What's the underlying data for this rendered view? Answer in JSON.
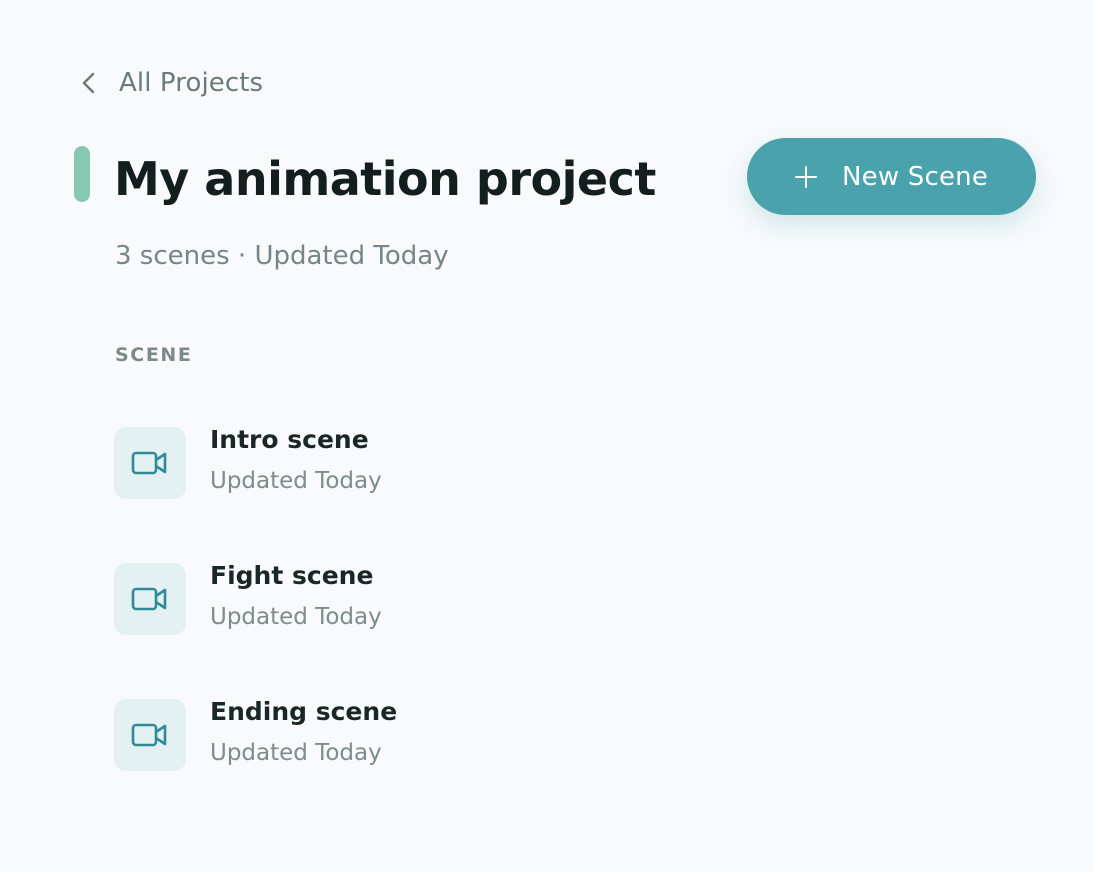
{
  "nav": {
    "back_label": "All Projects"
  },
  "project": {
    "title": "My animation project",
    "subtitle": "3 scenes · Updated Today"
  },
  "actions": {
    "new_scene_label": "New Scene"
  },
  "scenes": {
    "header": "SCENE",
    "items": [
      {
        "name": "Intro scene",
        "meta": "Updated Today",
        "icon": "video-camera-icon"
      },
      {
        "name": "Fight scene",
        "meta": "Updated Today",
        "icon": "video-camera-icon"
      },
      {
        "name": "Ending scene",
        "meta": "Updated Today",
        "icon": "video-camera-icon"
      }
    ]
  },
  "colors": {
    "background": "#f8fafc",
    "accent": "#4aa2ad",
    "title_marker": "#86c9b3",
    "icon_tile": "#e3f1f2",
    "icon_stroke": "#2f8b95"
  }
}
